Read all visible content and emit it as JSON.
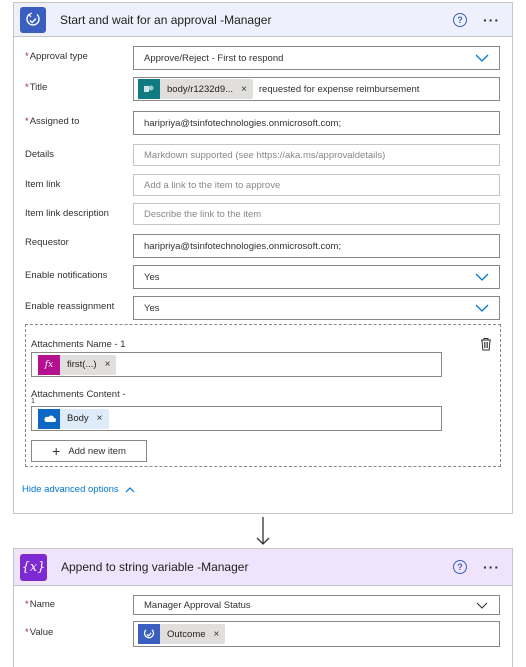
{
  "approval_card": {
    "title": "Start and wait for an approval -Manager",
    "help": "?",
    "more": "···",
    "fields": {
      "approval_type": {
        "label": "Approval type",
        "required": "*",
        "value": "Approve/Reject - First to respond"
      },
      "title": {
        "label": "Title",
        "required": "*",
        "token": "body/r1232d9...",
        "token_x": "×",
        "suffix": "requested for expense reimbursement"
      },
      "assigned_to": {
        "label": "Assigned to",
        "required": "*",
        "value": "haripriya@tsinfotechnologies.onmicrosoft.com;"
      },
      "details": {
        "label": "Details",
        "placeholder": "Markdown supported (see https://aka.ms/approvaldetails)"
      },
      "item_link": {
        "label": "Item link",
        "placeholder": "Add a link to the item to approve"
      },
      "item_link_description": {
        "label": "Item link description",
        "placeholder": "Describe the link to the item"
      },
      "requestor": {
        "label": "Requestor",
        "value": "haripriya@tsinfotechnologies.onmicrosoft.com;"
      },
      "enable_notifications": {
        "label": "Enable notifications",
        "value": "Yes"
      },
      "enable_reassignment": {
        "label": "Enable reassignment",
        "value": "Yes"
      }
    },
    "attachments": {
      "name_label": "Attachments Name - 1",
      "name_token": "first(...)",
      "name_token_icon": "fx",
      "content_label": "Attachments Content -",
      "content_label_cont": "1",
      "content_token": "Body",
      "token_x": "×",
      "add_item": "Add new item",
      "add_plus": "+"
    },
    "hide_advanced": "Hide advanced options"
  },
  "variable_card": {
    "title": "Append to string variable -Manager",
    "icon_text": "{x}",
    "help": "?",
    "more": "···",
    "fields": {
      "name": {
        "label": "Name",
        "required": "*",
        "value": "Manager Approval Status"
      },
      "value": {
        "label": "Value",
        "required": "*",
        "token": "Outcome",
        "token_x": "×"
      }
    }
  },
  "colors": {
    "approval_header": "#eef0fb",
    "variable_header": "#efe4fb",
    "approval_icon": "#3b5fc1",
    "variable_icon": "#7e2ad3",
    "expression_token": "#b4108f",
    "sharepoint_token": "#0f7a80",
    "onedrive_token": "#0f67c4",
    "link": "#0078d4"
  },
  "icons": [
    "approval-icon",
    "help-icon",
    "more-icon",
    "chevron-down-icon",
    "sharepoint-icon",
    "fx-icon",
    "onedrive-icon",
    "trash-icon",
    "plus-icon",
    "chevron-up-icon",
    "arrow-down-icon",
    "variable-icon"
  ]
}
